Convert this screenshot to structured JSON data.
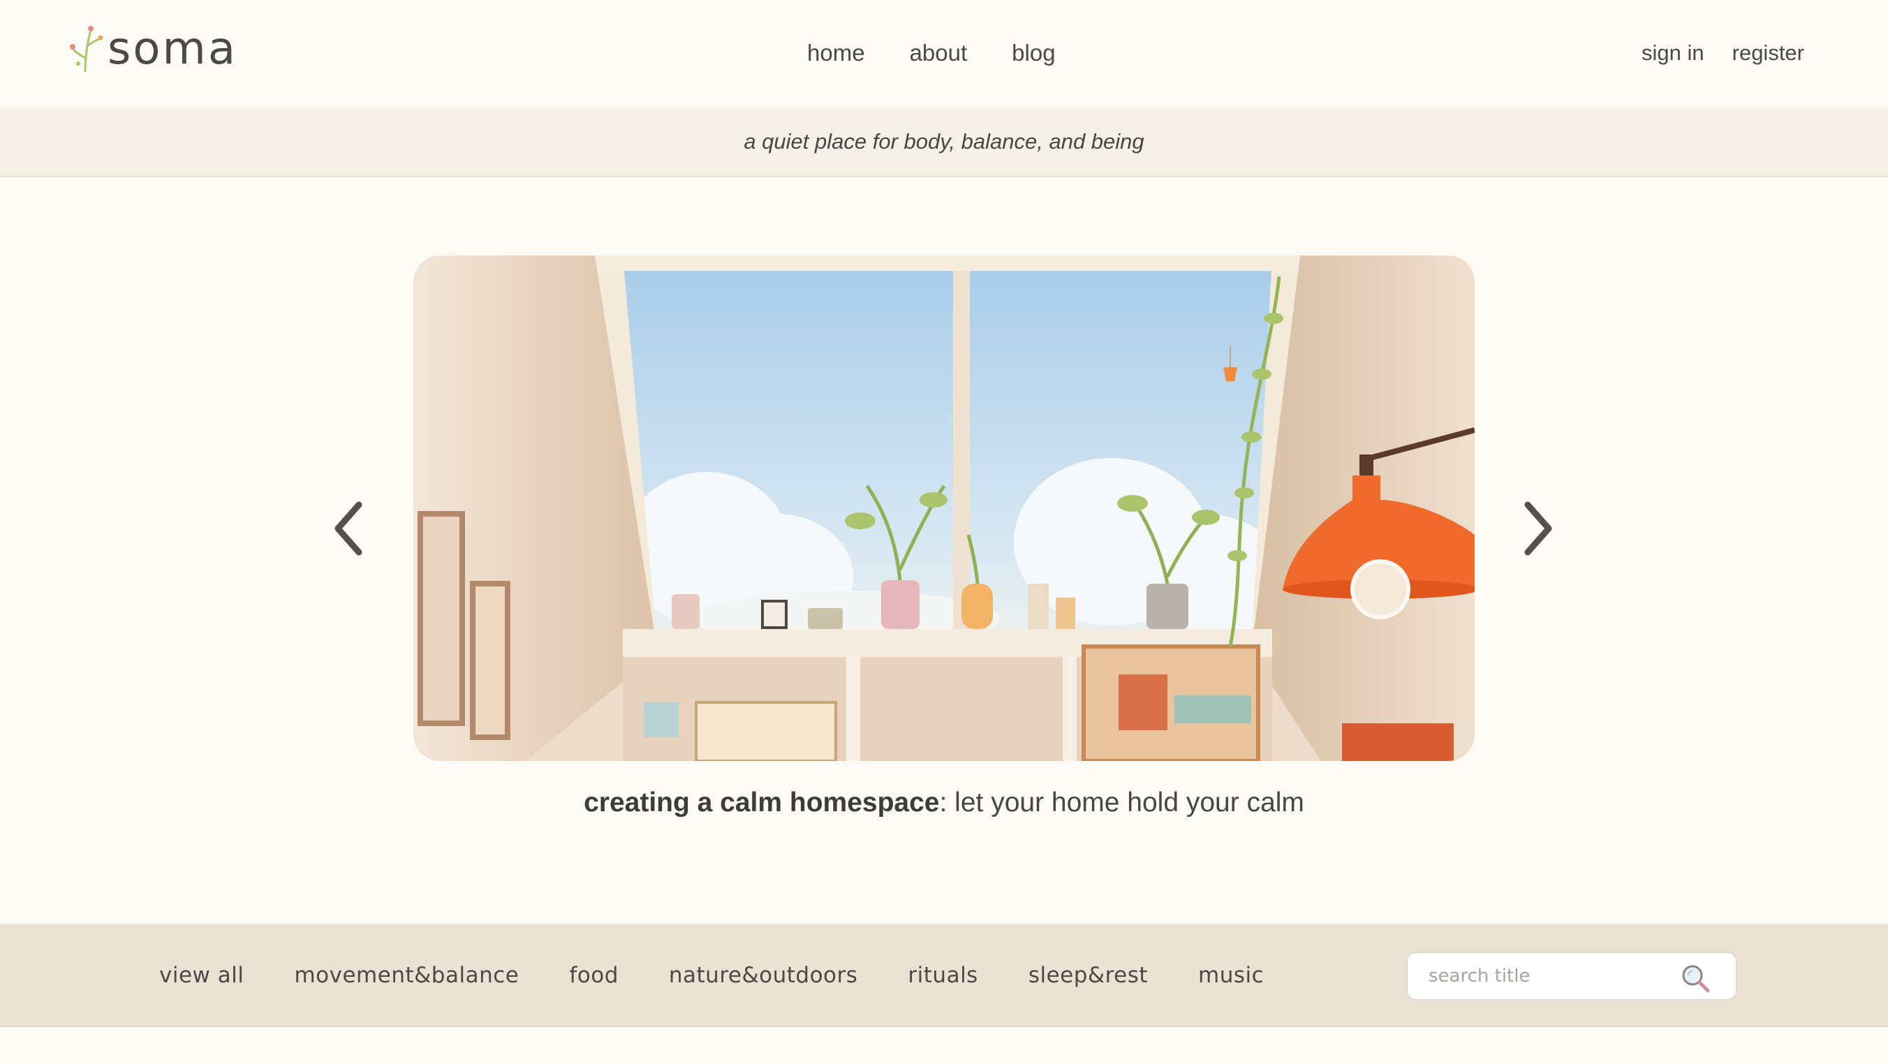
{
  "header": {
    "logo_text": "soma",
    "nav_center": [
      "home",
      "about",
      "blog"
    ],
    "nav_right": [
      "sign in",
      "register"
    ]
  },
  "tagline": "a quiet place for body, balance, and being",
  "hero": {
    "caption_title": "creating a calm homespace",
    "caption_rest": ": let your home hold your calm",
    "image_description": "illustration of a sunny attic room with skylight, plants and orange lamp",
    "prev_icon": "chevron-left-icon",
    "next_icon": "chevron-right-icon"
  },
  "categories": [
    "view all",
    "movement&balance",
    "food",
    "nature&outdoors",
    "rituals",
    "sleep&rest",
    "music"
  ],
  "search": {
    "placeholder": "search title",
    "icon": "search-icon"
  },
  "colors": {
    "background": "#fdfbf5",
    "tagline_bg": "#f6f1e6",
    "category_bg": "#ebe2d4",
    "text": "#4a4542",
    "accent_orange": "#f06a2c"
  }
}
